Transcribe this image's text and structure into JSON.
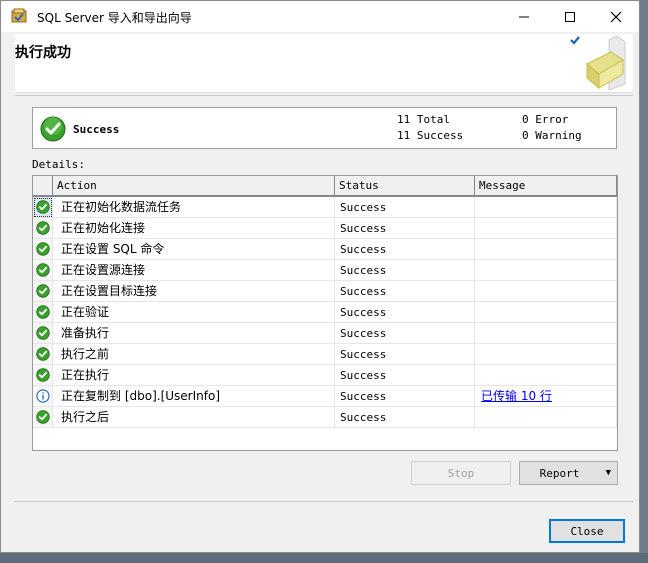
{
  "window": {
    "title": "SQL Server 导入和导出向导",
    "controls": {
      "minimize": "—",
      "maximize": "☐",
      "close": "✕"
    }
  },
  "header": {
    "title": "执行成功"
  },
  "summary": {
    "status": "Success",
    "total": "11 Total",
    "success": "11 Success",
    "error": "0 Error",
    "warning": "0 Warning"
  },
  "details": {
    "label": "Details:",
    "columns": [
      "Action",
      "Status",
      "Message"
    ],
    "rows": [
      {
        "icon": "success-icon",
        "action": "正在初始化数据流任务",
        "status": "Success",
        "message": ""
      },
      {
        "icon": "success-icon",
        "action": "正在初始化连接",
        "status": "Success",
        "message": ""
      },
      {
        "icon": "success-icon",
        "action": "正在设置 SQL 命令",
        "status": "Success",
        "message": ""
      },
      {
        "icon": "success-icon",
        "action": "正在设置源连接",
        "status": "Success",
        "message": ""
      },
      {
        "icon": "success-icon",
        "action": "正在设置目标连接",
        "status": "Success",
        "message": ""
      },
      {
        "icon": "success-icon",
        "action": "正在验证",
        "status": "Success",
        "message": ""
      },
      {
        "icon": "success-icon",
        "action": "准备执行",
        "status": "Success",
        "message": ""
      },
      {
        "icon": "success-icon",
        "action": "执行之前",
        "status": "Success",
        "message": ""
      },
      {
        "icon": "success-icon",
        "action": "正在执行",
        "status": "Success",
        "message": ""
      },
      {
        "icon": "info-icon",
        "action": "正在复制到 [dbo].[UserInfo]",
        "status": "Success",
        "message": "已传输 10 行"
      },
      {
        "icon": "success-icon",
        "action": "执行之后",
        "status": "Success",
        "message": ""
      }
    ]
  },
  "buttons": {
    "stop": "Stop",
    "report": "Report",
    "report_arrow": "▼",
    "close": "Close"
  },
  "colors": {
    "success_green": "#3aa12c",
    "info_blue": "#2b6cc4",
    "link": "#0000ee",
    "default_button_border": "#0078d7"
  }
}
